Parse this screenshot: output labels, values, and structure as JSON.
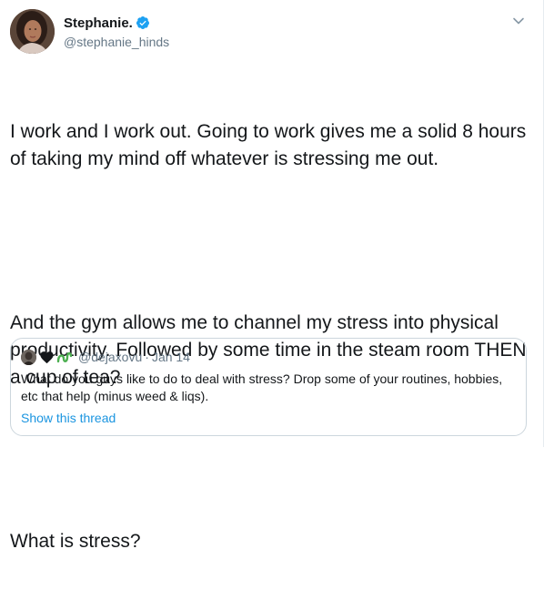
{
  "author": {
    "display_name": "Stephanie.",
    "handle": "@stephanie_hinds",
    "verified": true
  },
  "icons": {
    "verified": "verified-badge-icon",
    "more": "chevron-down-icon",
    "heart": "black-heart-icon",
    "emoji": "green-squiggle-icon"
  },
  "tweet": {
    "paragraphs": [
      "I work and I work out. Going to work gives me a solid 8 hours of taking my mind off whatever is stressing me out.",
      "And the gym allows me to channel my stress into physical productivity. Followed by some time in the steam room THEN a cup of tea?",
      "What is stress?"
    ]
  },
  "quote": {
    "handle": "@dejaxovu",
    "separator": "·",
    "date": "Jan 14",
    "text": "What do you guys like to do to deal with stress? Drop some of your routines, hobbies, etc that help (minus weed & liqs).",
    "show_thread_label": "Show this thread"
  },
  "colors": {
    "text": "#14171a",
    "secondary": "#657786",
    "link": "#1b95e0",
    "verified": "#1da1f2",
    "border": "#ccd6dd"
  }
}
